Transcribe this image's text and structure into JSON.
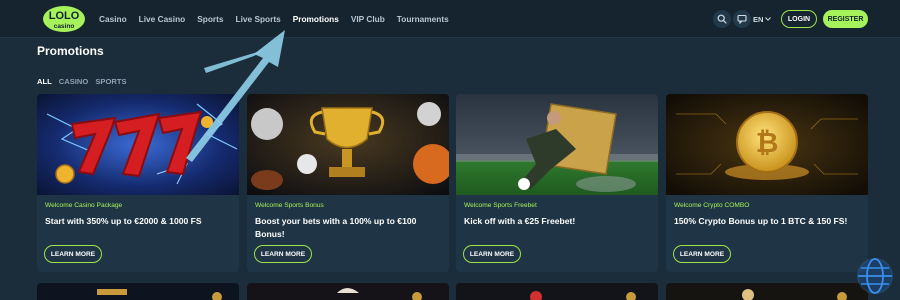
{
  "header": {
    "logo_text": "LOLO casino",
    "nav": [
      "Casino",
      "Live Casino",
      "Sports",
      "Live Sports",
      "Promotions",
      "VIP Club",
      "Tournaments"
    ],
    "active_nav": "Promotions",
    "search_icon": "search-icon",
    "chat_icon": "chat-icon",
    "language": "EN",
    "login_label": "LOGIN",
    "register_label": "REGISTER"
  },
  "page": {
    "title": "Promotions",
    "filters": [
      "ALL",
      "CASINO",
      "SPORTS"
    ],
    "active_filter": "ALL"
  },
  "cards": [
    {
      "kicker": "Welcome Casino Package",
      "headline": "Start with 350% up to €2000 & 1000 FS",
      "button": "LEARN MORE",
      "art": "red-sevens-slot-art"
    },
    {
      "kicker": "Welcome Sports Bonus",
      "headline": "Boost your bets with a 100% up to €100 Bonus!",
      "button": "LEARN MORE",
      "art": "gold-trophy-balls-art"
    },
    {
      "kicker": "Welcome Sports Freebet",
      "headline": "Kick off with a €25 Freebet!",
      "button": "LEARN MORE",
      "art": "footballer-ticket-art"
    },
    {
      "kicker": "Welcome Crypto COMBO",
      "headline": "150% Crypto Bonus up to 1 BTC & 150 FS!",
      "button": "LEARN MORE",
      "art": "bitcoin-coin-art"
    }
  ],
  "colors": {
    "background": "#1b2d3a",
    "header": "#16242f",
    "card": "#1f3444",
    "accent_green": "#a6f25a",
    "annotation_arrow": "#8ccde6"
  },
  "overlay": {
    "arrow_target": "Promotions",
    "corner_widget": "globe-icon"
  }
}
